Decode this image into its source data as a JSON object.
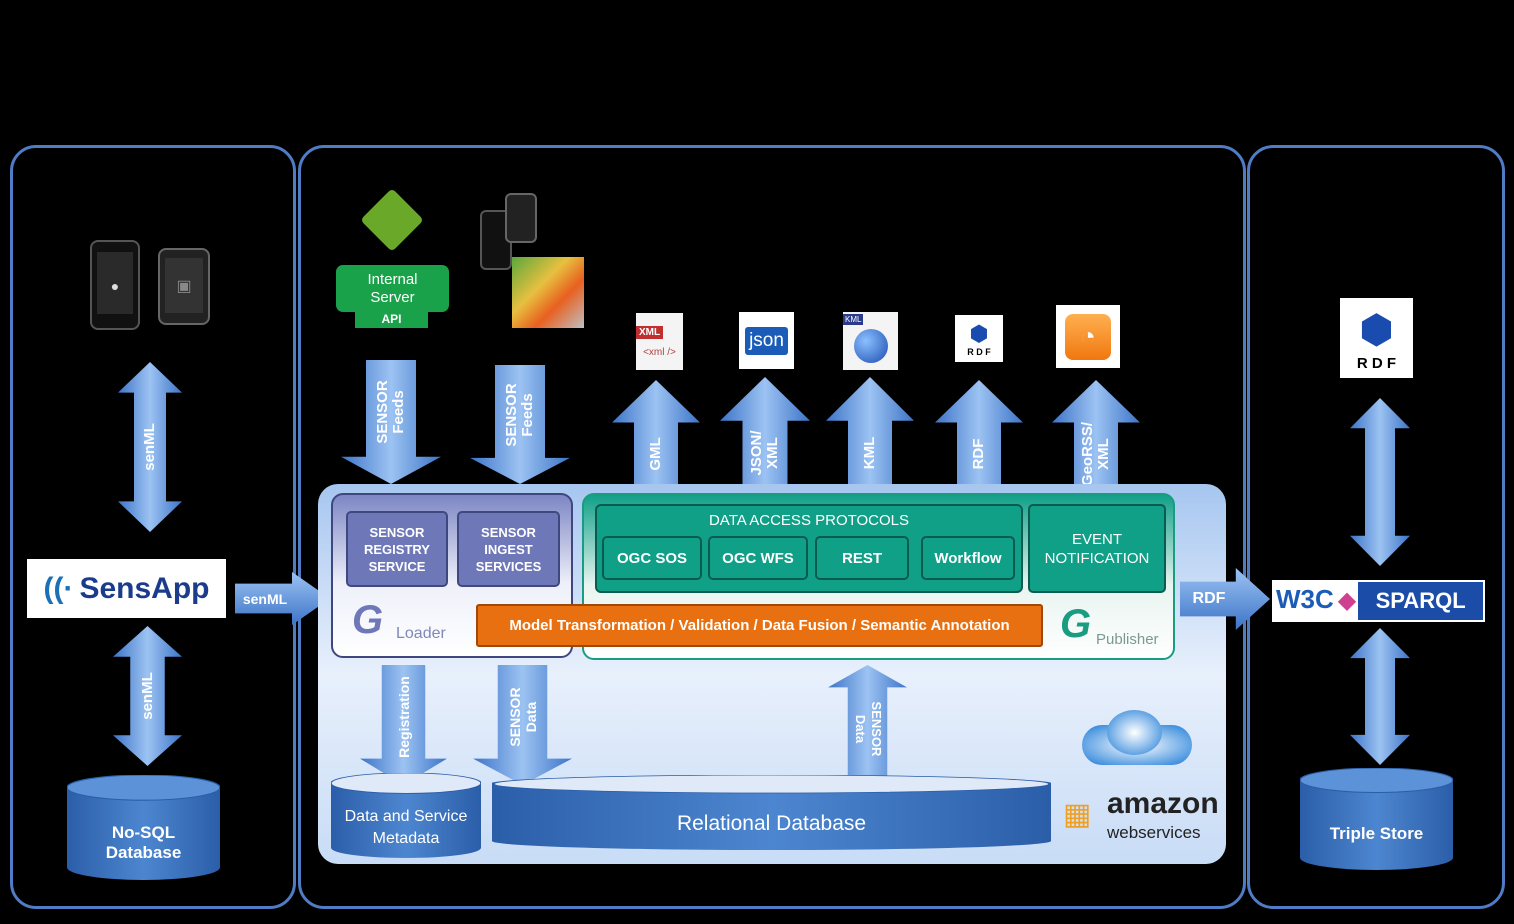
{
  "colors": {
    "panel_border": "#4f7cc4",
    "arrow": "#6fa0e0",
    "teal": "#10a088",
    "orange": "#e87010",
    "purple": "#6e78b8",
    "green": "#1aa24a"
  },
  "left": {
    "senml_top": "senML",
    "senml_bottom": "senML",
    "sensapp_logo": "SensApp",
    "nosql": "No-SQL\nDatabase",
    "senml_right": "senML"
  },
  "middle": {
    "internal_server": "Internal\nServer",
    "api": "API",
    "feeds": [
      "SENSOR\nFeeds",
      "SENSOR\nFeeds"
    ],
    "outputs": [
      "GML",
      "JSON/\nXML",
      "KML",
      "RDF",
      "GeoRSS/\nXML"
    ],
    "icons": {
      "xml": "XML",
      "xml_tag": "<xml />",
      "json": "json",
      "kml": "KML",
      "rdf": "R D F"
    },
    "loader": {
      "services": [
        "SENSOR\nREGISTRY\nSERVICE",
        "SENSOR\nINGEST\nSERVICES"
      ],
      "logo": "Loader"
    },
    "publisher": {
      "protocols_title": "DATA ACCESS PROTOCOLS",
      "protocols": [
        "OGC SOS",
        "OGC WFS",
        "REST",
        "Workflow"
      ],
      "event": "EVENT\nNOTIFICATION",
      "logo": "Publisher"
    },
    "model_bar": "Model Transformation / Validation / Data Fusion / Semantic Annotation",
    "down_arrows": [
      "Registration",
      "SENSOR\nData"
    ],
    "up_arrow": "SENSOR\nData",
    "metadata_db": "Data and Service\nMetadata",
    "relational_db": "Relational Database",
    "amazon": {
      "name": "amazon",
      "sub": "webservices"
    }
  },
  "right": {
    "rdf_arrow": "RDF",
    "rdf_logo": "R D F",
    "w3c": "W3C",
    "sparql": "SPARQL",
    "triple_store": "Triple Store"
  }
}
